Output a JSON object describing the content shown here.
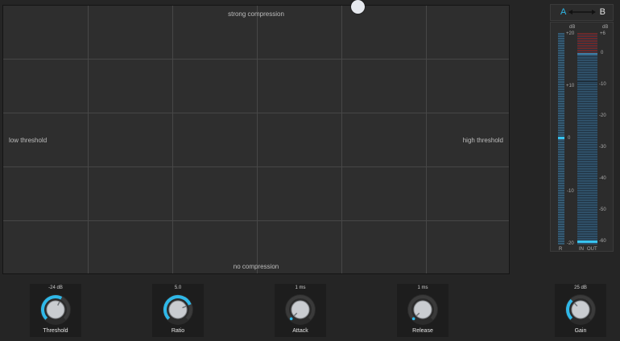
{
  "xy_pad": {
    "top_label": "strong compression",
    "bottom_label": "no compression",
    "left_label": "low threshold",
    "right_label": "high threshold"
  },
  "ab": {
    "a_label": "A",
    "b_label": "B"
  },
  "meter": {
    "left_unit": "dB",
    "right_unit": "dB",
    "left_scale": [
      "+20",
      "+10",
      "0",
      "-10",
      "-20"
    ],
    "right_scale": [
      "+6",
      "0",
      "-10",
      "-20",
      "-30",
      "-40",
      "-50",
      "-60"
    ],
    "r_label": "R",
    "in_label": "IN",
    "out_label": "OUT"
  },
  "knobs": [
    {
      "name": "Threshold",
      "value": "-24 dB",
      "level": 0.6
    },
    {
      "name": "Ratio",
      "value": "5.0",
      "level": 0.75
    },
    {
      "name": "Attack",
      "value": "1 ms",
      "level": 0.0
    },
    {
      "name": "Release",
      "value": "1 ms",
      "level": 0.0
    },
    {
      "name": "Gain",
      "value": "25 dB",
      "level": 0.34
    }
  ],
  "colors": {
    "accent": "#2fb8e8",
    "knob_body": "#c9ccd0",
    "background": "#252525"
  }
}
